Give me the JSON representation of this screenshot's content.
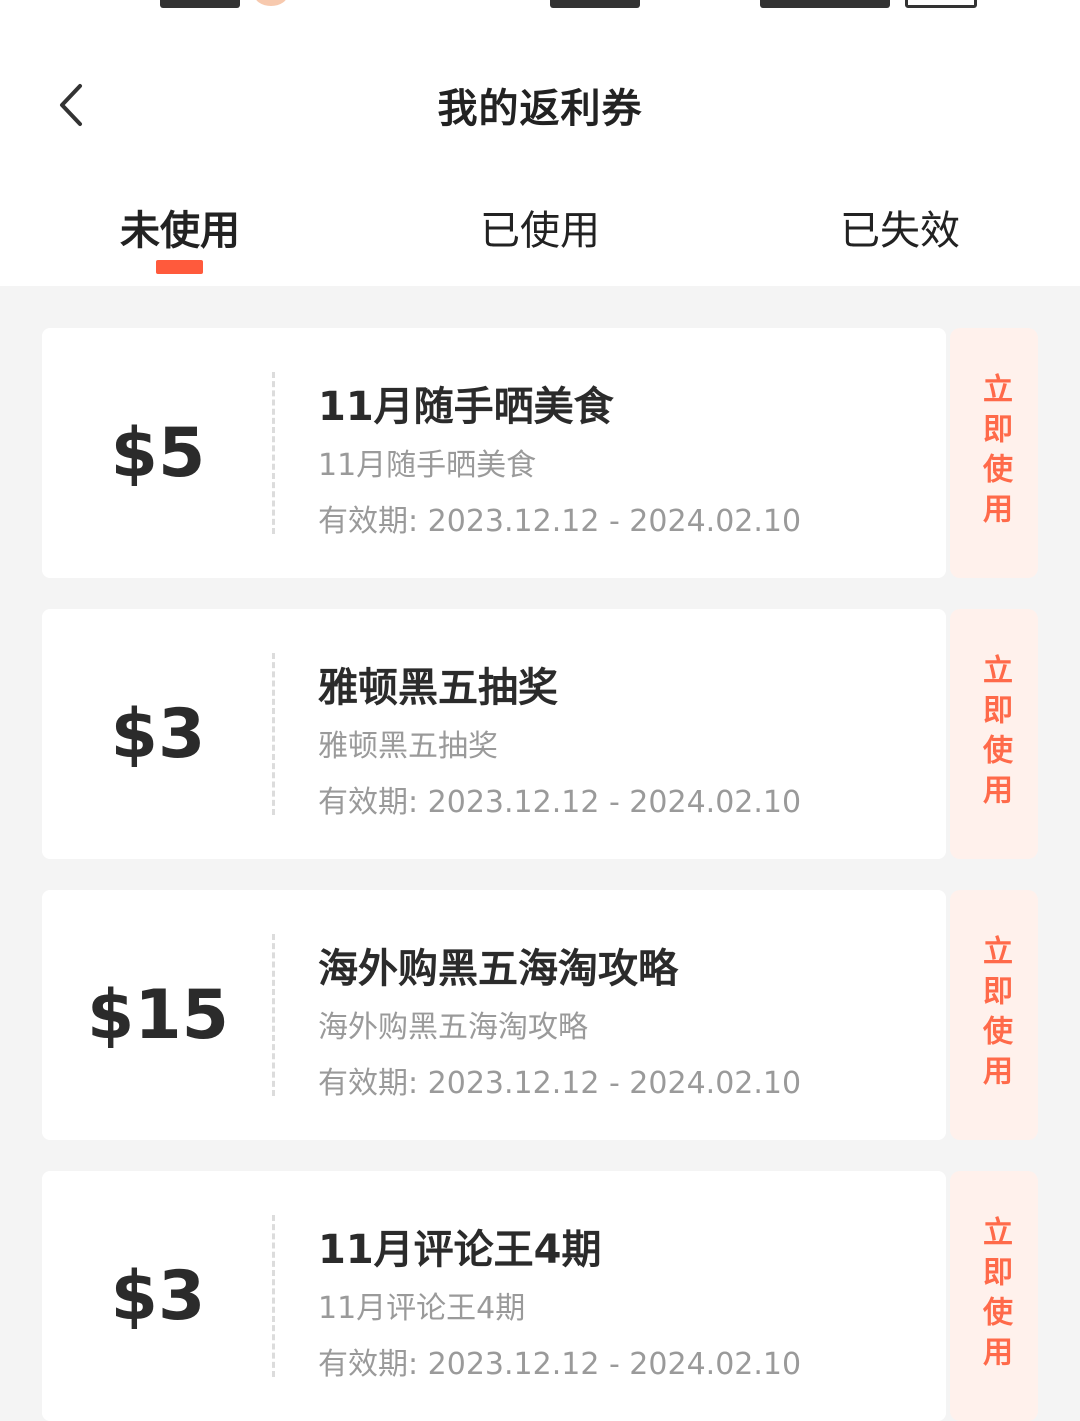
{
  "header": {
    "title": "我的返利券",
    "back_icon": "chevron-left-icon"
  },
  "tabs": [
    {
      "label": "未使用",
      "active": true
    },
    {
      "label": "已使用",
      "active": false
    },
    {
      "label": "已失效",
      "active": false
    }
  ],
  "colors": {
    "accent": "#ff5a3c",
    "button_bg": "#fff1ec",
    "button_text": "#ff6a4a"
  },
  "coupons": [
    {
      "amount": "$5",
      "title": "11月随手晒美食",
      "subtitle": "11月随手晒美食",
      "validity": "有效期: 2023.12.12 - 2024.02.10",
      "action": "立即使用"
    },
    {
      "amount": "$3",
      "title": "雅顿黑五抽奖",
      "subtitle": "雅顿黑五抽奖",
      "validity": "有效期: 2023.12.12 - 2024.02.10",
      "action": "立即使用"
    },
    {
      "amount": "$15",
      "title": "海外购黑五海淘攻略",
      "subtitle": "海外购黑五海淘攻略",
      "validity": "有效期: 2023.12.12 - 2024.02.10",
      "action": "立即使用"
    },
    {
      "amount": "$3",
      "title": "11月评论王4期",
      "subtitle": "11月评论王4期",
      "validity": "有效期: 2023.12.12 - 2024.02.10",
      "action": "立即使用"
    }
  ]
}
